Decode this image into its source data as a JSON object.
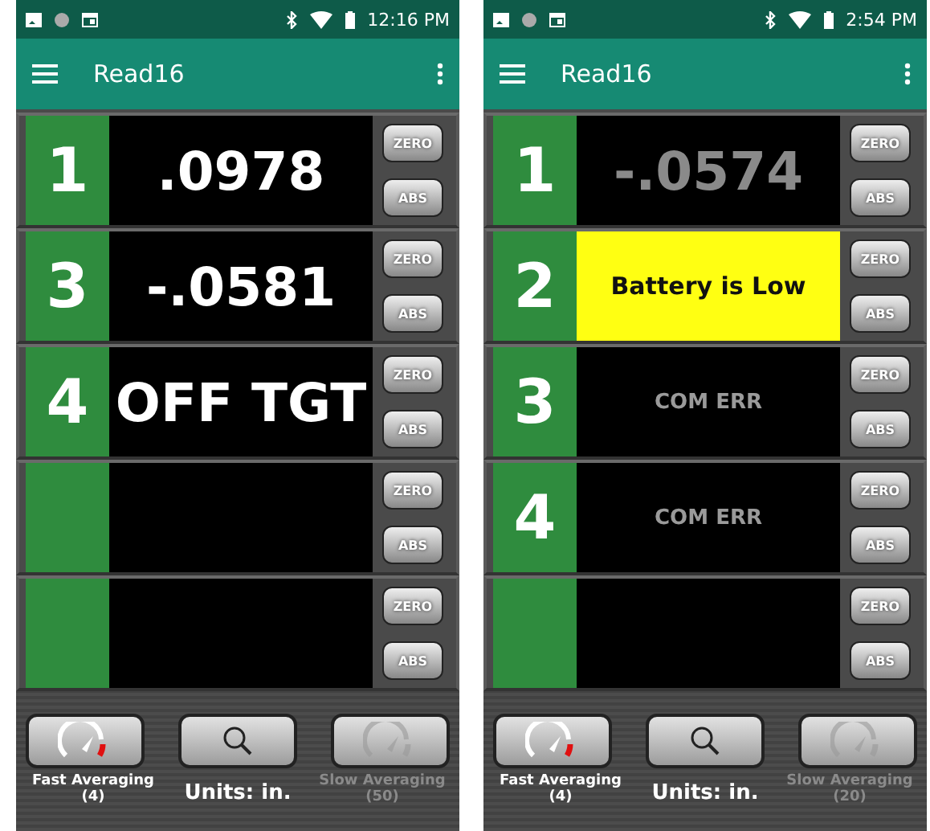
{
  "phones": [
    {
      "status_bar": {
        "time": "12:16 PM"
      },
      "app_bar": {
        "title": "Read16"
      },
      "gauges": [
        {
          "number": "1",
          "kind": "value",
          "reading": ".0978",
          "zero": "ZERO",
          "abs": "ABS"
        },
        {
          "number": "3",
          "kind": "value",
          "reading": "-.0581",
          "zero": "ZERO",
          "abs": "ABS"
        },
        {
          "number": "4",
          "kind": "value",
          "reading": "OFF TGT",
          "zero": "ZERO",
          "abs": "ABS"
        },
        {
          "kind": "empty",
          "zero": "ZERO",
          "abs": "ABS"
        },
        {
          "kind": "empty",
          "zero": "ZERO",
          "abs": "ABS"
        }
      ],
      "controls": [
        {
          "kind": "fast",
          "label": "Fast Averaging",
          "count": "(4)",
          "disabled": false
        },
        {
          "kind": "search"
        },
        {
          "kind": "slow",
          "label": "Slow Averaging",
          "count": "(50)",
          "disabled": true
        }
      ],
      "units": "Units: in."
    },
    {
      "status_bar": {
        "time": "2:54 PM"
      },
      "app_bar": {
        "title": "Read16"
      },
      "gauges": [
        {
          "number": "1",
          "kind": "stale",
          "reading": "-.0574",
          "zero": "ZERO",
          "abs": "ABS"
        },
        {
          "number": "2",
          "kind": "alert",
          "reading": "Battery is Low",
          "zero": "ZERO",
          "abs": "ABS"
        },
        {
          "number": "3",
          "kind": "error",
          "reading": "COM ERR",
          "zero": "ZERO",
          "abs": "ABS"
        },
        {
          "number": "4",
          "kind": "error",
          "reading": "COM ERR",
          "zero": "ZERO",
          "abs": "ABS"
        },
        {
          "kind": "empty",
          "zero": "ZERO",
          "abs": "ABS"
        }
      ],
      "controls": [
        {
          "kind": "fast",
          "label": "Fast Averaging",
          "count": "(4)",
          "disabled": false
        },
        {
          "kind": "search"
        },
        {
          "kind": "slow",
          "label": "Slow Averaging",
          "count": "(20)",
          "disabled": true
        }
      ],
      "units": "Units: in."
    }
  ]
}
